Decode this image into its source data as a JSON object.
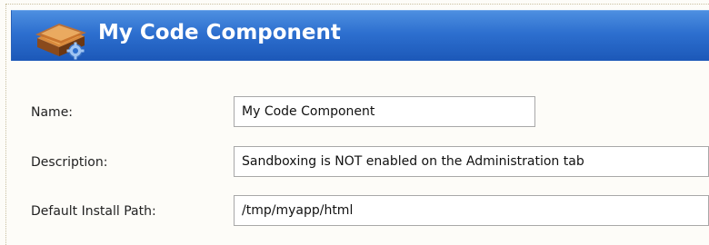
{
  "header": {
    "title": "My Code Component",
    "icon": "component-box-icon"
  },
  "form": {
    "name": {
      "label": "Name:",
      "value": "My Code Component"
    },
    "description": {
      "label": "Description:",
      "value": "Sandboxing is NOT enabled on the Administration tab"
    },
    "install_path": {
      "label": "Default Install Path:",
      "value": "/tmp/myapp/html"
    }
  },
  "colors": {
    "header_blue": "#2d6fcf",
    "panel_background": "#fdfcf8",
    "input_border": "#a8a8a8"
  }
}
